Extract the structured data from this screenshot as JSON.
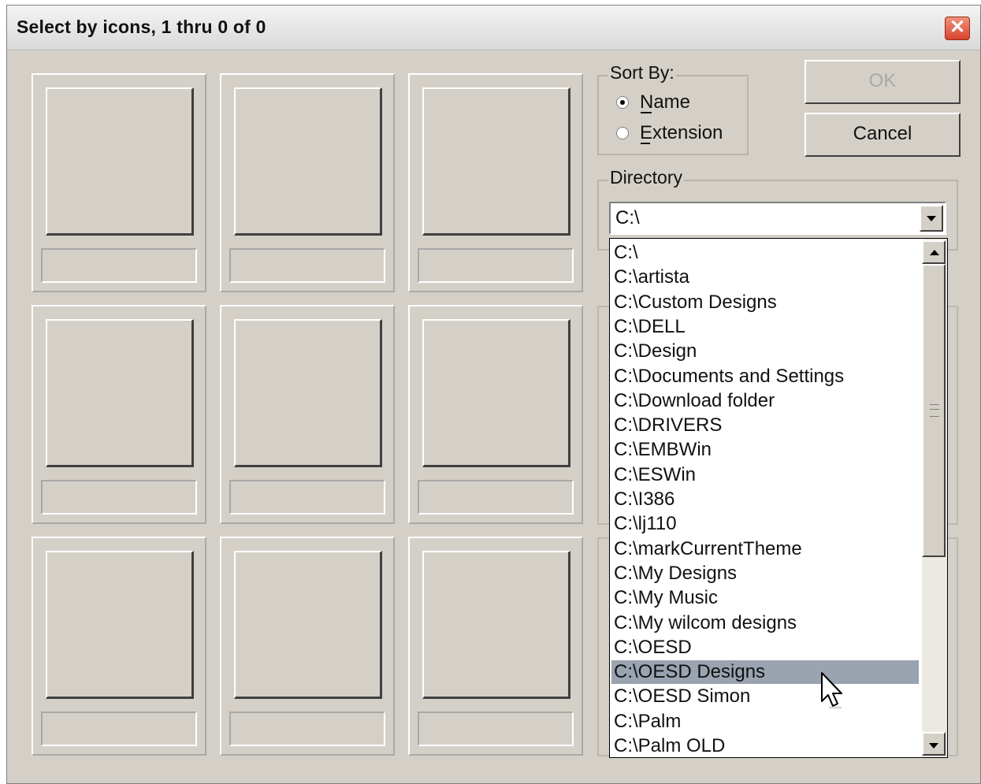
{
  "window": {
    "title": "Select by icons, 1 thru 0 of 0",
    "close_glyph": "✕"
  },
  "sort_by": {
    "label": "Sort By:",
    "options": [
      {
        "label": "Name",
        "selected": true
      },
      {
        "label": "Extension",
        "selected": false
      }
    ]
  },
  "buttons": {
    "ok": "OK",
    "cancel": "Cancel"
  },
  "directory": {
    "label": "Directory",
    "value": "C:\\",
    "options": [
      "C:\\",
      "C:\\artista",
      "C:\\Custom Designs",
      "C:\\DELL",
      "C:\\Design",
      "C:\\Documents and Settings",
      "C:\\Download folder",
      "C:\\DRIVERS",
      "C:\\EMBWin",
      "C:\\ESWin",
      "C:\\I386",
      "C:\\lj110",
      "C:\\markCurrentTheme",
      "C:\\My Designs",
      "C:\\My Music",
      "C:\\My wilcom designs",
      "C:\\OESD",
      "C:\\OESD Designs",
      "C:\\OESD Simon",
      "C:\\Palm",
      "C:\\Palm OLD"
    ],
    "highlighted": "C:\\OESD Designs"
  },
  "icons": {
    "colors": {
      "face": "#d4d0c8",
      "highlight": "#9aa3b0",
      "close": "#d9442c"
    }
  }
}
